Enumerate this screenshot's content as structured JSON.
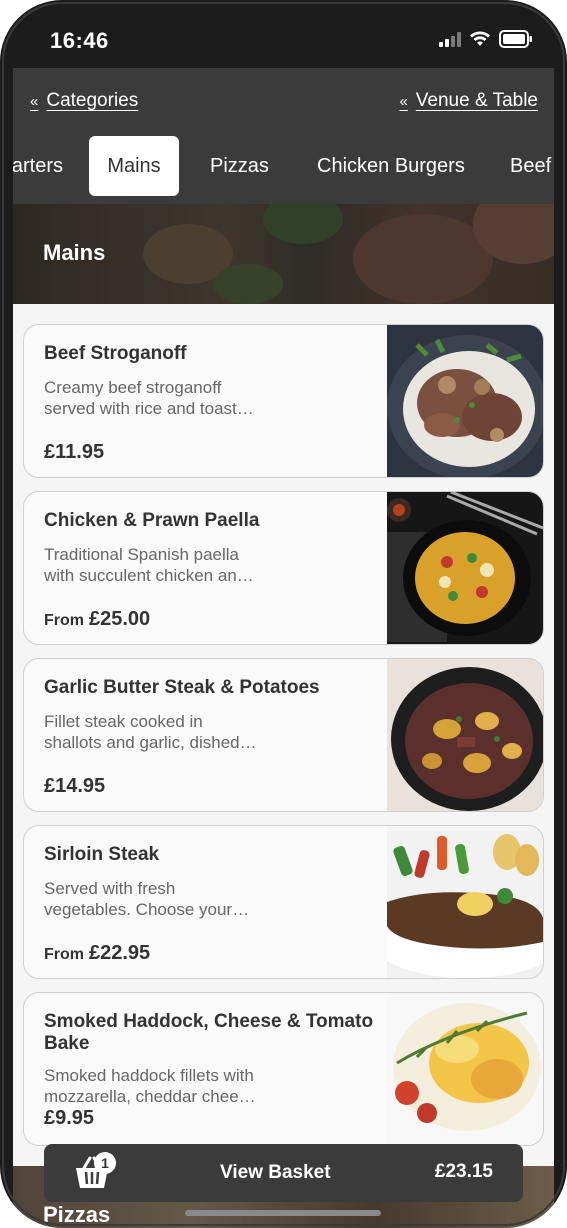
{
  "status": {
    "time": "16:46"
  },
  "nav": {
    "back_categories": "Categories",
    "back_venue": "Venue & Table",
    "chevron": "«"
  },
  "categories": [
    {
      "label": "Starters",
      "active": false
    },
    {
      "label": "Mains",
      "active": true
    },
    {
      "label": "Pizzas",
      "active": false
    },
    {
      "label": "Chicken Burgers",
      "active": false
    },
    {
      "label": "Beef",
      "active": false
    }
  ],
  "section": {
    "title": "Mains"
  },
  "items": [
    {
      "name": "Beef Stroganoff",
      "desc_line1": "Creamy beef stroganoff",
      "desc_line2": "served with rice and toast…",
      "price_prefix": "",
      "price": "£11.95"
    },
    {
      "name": "Chicken & Prawn Paella",
      "desc_line1": "Traditional Spanish paella",
      "desc_line2": "with succulent chicken an…",
      "price_prefix": "From",
      "price": "£25.00"
    },
    {
      "name": "Garlic Butter Steak & Potatoes",
      "desc_line1": "Fillet steak cooked in",
      "desc_line2": "shallots and garlic, dished…",
      "price_prefix": "",
      "price": "£14.95"
    },
    {
      "name": "Sirloin Steak",
      "desc_line1": "Served with fresh",
      "desc_line2": "vegetables. Choose your…",
      "price_prefix": "From",
      "price": "£22.95"
    },
    {
      "name": "Smoked Haddock, Cheese & Tomato Bake",
      "desc_line1": "Smoked haddock fillets with",
      "desc_line2": "mozzarella, cheddar chee…",
      "price_prefix": "",
      "price": "£9.95"
    }
  ],
  "basket": {
    "count": "1",
    "label": "View Basket",
    "total": "£23.15"
  },
  "next_section": {
    "title": "Pizzas"
  },
  "colors": {
    "header": "#3b3b3b",
    "accent": "#ffffff",
    "text": "#333333"
  }
}
